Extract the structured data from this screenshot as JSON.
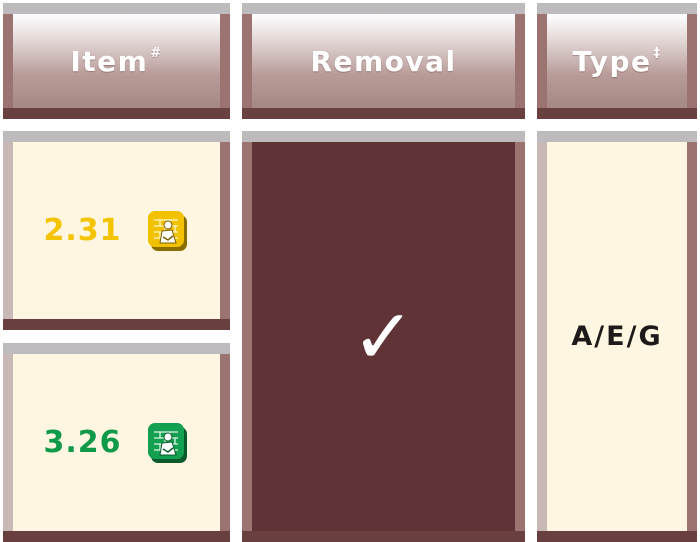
{
  "header": {
    "item_label": "Item",
    "item_mark": "#",
    "removal_label": "Removal",
    "type_label": "Type",
    "type_mark": "‡"
  },
  "rows": {
    "item_values": [
      {
        "value": "2.31",
        "color": "#f5c400",
        "icon": "brick-wall-worker-icon"
      },
      {
        "value": "3.26",
        "color": "#0f9a4a",
        "icon": "brick-wall-worker-icon"
      }
    ],
    "removal_mark": "✓",
    "type_value": "A/E/G"
  },
  "colors": {
    "header_gradient_top": "#ffffff",
    "header_gradient_bottom": "#a68885",
    "cream": "#fff6e1",
    "dark_cell": "#603437",
    "frame_dark": "#6a3f3f",
    "frame_grey": "#bdbbbd"
  }
}
